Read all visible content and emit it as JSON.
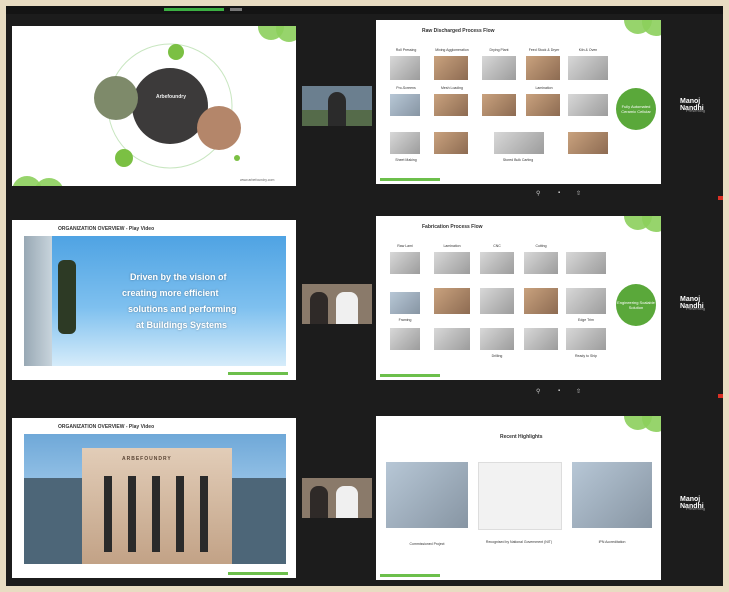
{
  "meeting": {
    "participant_name": "Manoj Nandhi",
    "participant_sub": "Presenting"
  },
  "rows": [
    {
      "left_slide": {
        "center_label": "Arbefoundry",
        "footer": "www.arbefoundry.com"
      },
      "right_slide": {
        "title": "Raw Discharged Process Flow",
        "oval_text": "Fully Automated Ceramic Cellular",
        "labels": [
          "Roll Pressing",
          "Mixing Agglomeration",
          "Drying Plant",
          "Feed Stock & Dryer",
          "Kiln & Oven",
          "Pro-Screens",
          "Mesh Loading",
          "Lamination",
          "Sheet Making",
          "Stored Bulk Carting"
        ]
      }
    },
    {
      "left_slide": {
        "header": "ORGANIZATION OVERVIEW - Play Video",
        "lines": [
          "Driven by the vision of",
          "creating more efficient",
          "solutions and performing",
          "at Buildings Systems"
        ]
      },
      "right_slide": {
        "title": "Fabrication Process Flow",
        "oval_text": "Engineering Scalable Solution",
        "labels": [
          "Raw Lami",
          "Lamination",
          "CNC",
          "Cutting",
          "Framing",
          "Edge Trim",
          "Drilling",
          "Ready to Ship"
        ]
      }
    },
    {
      "left_slide": {
        "header": "ORGANIZATION OVERVIEW - Play Video",
        "building_sign": "ARBEFOUNDRY"
      },
      "right_slide": {
        "title": "Recent Highlights",
        "captions": [
          "Commissioned Project",
          "Recognised by National Government (NIT)",
          "IPN Accreditation"
        ]
      }
    }
  ],
  "colors": {
    "accent": "#6cbf4b",
    "background": "#1c1c1c"
  }
}
